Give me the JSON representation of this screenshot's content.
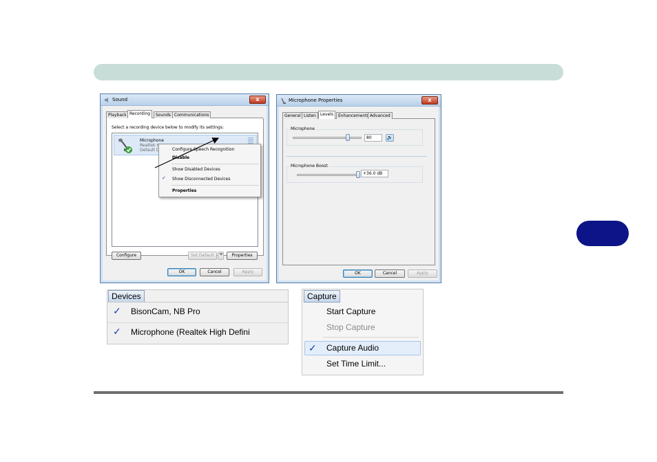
{
  "sound_window": {
    "title": "Sound",
    "tabs": [
      "Playback",
      "Recording",
      "Sounds",
      "Communications"
    ],
    "active_tab": "Recording",
    "instruction": "Select a recording device below to modify its settings:",
    "device": {
      "name": "Microphone",
      "line1": "Realtek H",
      "line2": "Default D"
    },
    "context_menu": {
      "items": [
        "Configure Speech Recognition",
        "Disable",
        "Show Disabled Devices",
        "Show Disconnected Devices",
        "Properties"
      ],
      "checked": "Show Disconnected Devices"
    },
    "buttons": {
      "configure": "Configure",
      "set_default": "Set Default",
      "properties": "Properties",
      "ok": "OK",
      "cancel": "Cancel",
      "apply": "Apply"
    },
    "close_glyph": "x"
  },
  "mic_window": {
    "title": "Microphone Properties",
    "tabs": [
      "General",
      "Listen",
      "Levels",
      "Enhancements",
      "Advanced"
    ],
    "active_tab": "Levels",
    "microphone": {
      "label": "Microphone",
      "value": "80",
      "level_fraction": 0.8
    },
    "boost": {
      "label": "Microphone Boost",
      "value": "+36.0 dB",
      "level_fraction": 1.0
    },
    "buttons": {
      "ok": "OK",
      "cancel": "Cancel",
      "apply": "Apply"
    },
    "close_glyph": "x"
  },
  "devices_menu": {
    "title": "Devices",
    "items": [
      {
        "label": "BisonCam, NB Pro",
        "checked": true
      },
      {
        "label": "Microphone (Realtek High Defini",
        "checked": true
      }
    ]
  },
  "capture_menu": {
    "title": "Capture",
    "items": [
      {
        "label": "Start Capture",
        "enabled": true,
        "checked": false
      },
      {
        "label": "Stop Capture",
        "enabled": false,
        "checked": false
      },
      {
        "label": "Capture Audio",
        "enabled": true,
        "checked": true
      },
      {
        "label": "Set Time Limit...",
        "enabled": true,
        "checked": false
      }
    ]
  },
  "glyphs": {
    "check": "✓",
    "speaker": "🔊"
  },
  "colors": {
    "header_bar": "#c9ddd8",
    "side_tab": "#0c1487",
    "footer_line": "#6f6f6f",
    "close_button": "#c0391f",
    "selection": "#dde9f7"
  }
}
